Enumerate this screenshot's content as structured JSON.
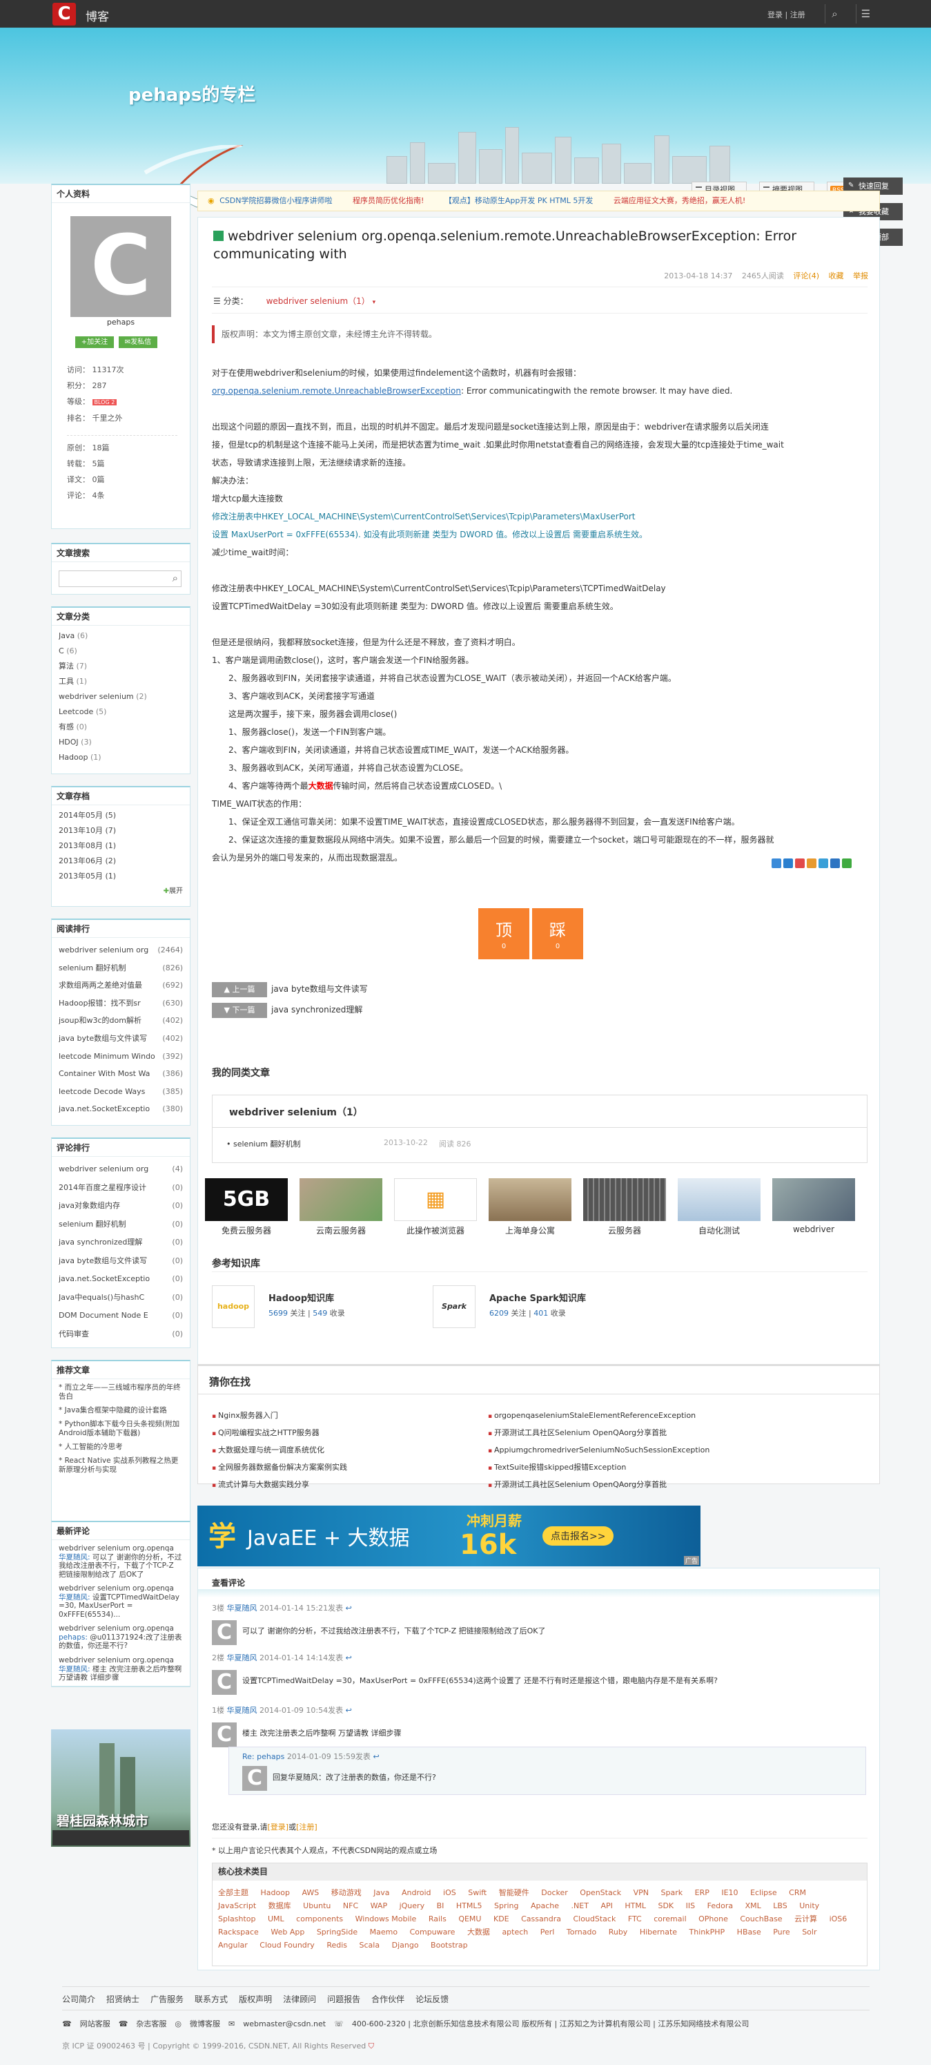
{
  "topbar": {
    "logo_text": "博客",
    "links": "登录 | 注册"
  },
  "banner": {
    "blog_title": "pehaps的专栏",
    "view_toc": "目录视图",
    "view_summary": "摘要视图",
    "rss": "RSS",
    "rss_label": "订阅"
  },
  "side_actions": [
    "快速回复",
    "我要收藏",
    "返回顶部"
  ],
  "profile": {
    "section_title": "个人资料",
    "username": "pehaps",
    "follow": "+加关注",
    "message": "✉发私信",
    "stats": [
      {
        "label": "访问：",
        "value": "11317次"
      },
      {
        "label": "积分：",
        "value": "287"
      },
      {
        "label": "等级：",
        "value": "BLOG 2"
      },
      {
        "label": "排名：",
        "value": "千里之外"
      }
    ],
    "counts": [
      {
        "label": "原创：",
        "value": "18篇"
      },
      {
        "label": "转载：",
        "value": "5篇"
      },
      {
        "label": "译文：",
        "value": "0篇"
      },
      {
        "label": "评论：",
        "value": "4条"
      }
    ]
  },
  "search": {
    "title": "文章搜索"
  },
  "categories": {
    "title": "文章分类",
    "items": [
      {
        "name": "Java",
        "count": "(6)"
      },
      {
        "name": "C",
        "count": "(6)"
      },
      {
        "name": "算法",
        "count": "(7)"
      },
      {
        "name": "工具",
        "count": "(1)"
      },
      {
        "name": "webdriver selenium",
        "count": "(2)"
      },
      {
        "name": "Leetcode",
        "count": "(5)"
      },
      {
        "name": "有感",
        "count": "(0)"
      },
      {
        "name": "HDOJ",
        "count": "(3)"
      },
      {
        "name": "Hadoop",
        "count": "(1)"
      }
    ]
  },
  "archive": {
    "title": "文章存档",
    "items": [
      "2014年05月 (5)",
      "2013年10月 (7)",
      "2013年08月 (1)",
      "2013年06月 (2)",
      "2013年05月 (1)"
    ],
    "more": "展开"
  },
  "top_read": {
    "title": "阅读排行",
    "items": [
      {
        "name": "webdriver selenium org",
        "count": "(2464)"
      },
      {
        "name": "selenium 翻好机制",
        "count": "(826)"
      },
      {
        "name": "求数组两两之差绝对值最",
        "count": "(692)"
      },
      {
        "name": "Hadoop报错：找不到sr",
        "count": "(630)"
      },
      {
        "name": "jsoup和w3c的dom解析",
        "count": "(402)"
      },
      {
        "name": "java byte数组与文件读写",
        "count": "(402)"
      },
      {
        "name": "leetcode Minimum Windo",
        "count": "(392)"
      },
      {
        "name": "Container With Most Wa",
        "count": "(386)"
      },
      {
        "name": "leetcode Decode Ways",
        "count": "(385)"
      },
      {
        "name": "java.net.SocketExceptio",
        "count": "(380)"
      }
    ]
  },
  "top_comment": {
    "title": "评论排行",
    "items": [
      {
        "name": "webdriver selenium org",
        "count": "(4)"
      },
      {
        "name": "2014年百度之星程序设计",
        "count": "(0)"
      },
      {
        "name": "java对象数组内存",
        "count": "(0)"
      },
      {
        "name": "selenium 翻好机制",
        "count": "(0)"
      },
      {
        "name": "java synchronized理解",
        "count": "(0)"
      },
      {
        "name": "java byte数组与文件读写",
        "count": "(0)"
      },
      {
        "name": "java.net.SocketExceptio",
        "count": "(0)"
      },
      {
        "name": "Java中equals()与hashC",
        "count": "(0)"
      },
      {
        "name": "DOM Document Node E",
        "count": "(0)"
      },
      {
        "name": "代码审查",
        "count": "(0)"
      }
    ]
  },
  "recommend": {
    "title": "推荐文章",
    "items": [
      "* 而立之年——三线城市程序员的年终告白",
      "* Java集合框架中隐藏的设计套路",
      "* Python脚本下载今日头条视频(附加Android版本辅助下载器)",
      "* 人工智能的冷思考",
      "* React Native 实战系列教程之热更新原理分析与实现"
    ]
  },
  "recent_comments": {
    "title": "最新评论",
    "items": [
      {
        "post": "webdriver selenium org.openqa",
        "who": "华夏随风:",
        "text": "可以了 谢谢你的分析，不过我给改注册表不行，下载了个TCP-Z 把链接限制给改了 后OK了"
      },
      {
        "post": "webdriver selenium org.openqa",
        "who": "华夏随风:",
        "text": "设置TCPTimedWaitDelay =30, MaxUserPort = 0xFFFE(65534)..."
      },
      {
        "post": "webdriver selenium org.openqa",
        "who": "pehaps:",
        "text": "@u011371924:改了注册表的数值，你还是不行?"
      },
      {
        "post": "webdriver selenium org.openqa",
        "who": "华夏随风:",
        "text": "楼主 改完注册表之后咋整啊 万望请教 详细步骤"
      }
    ]
  },
  "side_ad": {
    "text": "碧桂园森林城市"
  },
  "newsbar": [
    "CSDN学院招募微信小程序讲师啦",
    "程序员简历优化指南!",
    "【观点】移动原生App开发 PK HTML 5开发",
    "云端应用征文大赛，秀绝招，赢无人机!"
  ],
  "article": {
    "title": "webdriver selenium org.openqa.selenium.remote.UnreachableBrowserException: Error communicating with",
    "date": "2013-04-18 14:37",
    "reads": "2465人阅读",
    "comments": "评论(4)",
    "favorite": "收藏",
    "report": "举报",
    "category_label": "分类：",
    "category": "webdriver selenium（1）",
    "copyright": "版权声明：本文为博主原创文章，未经博主允许不得转载。",
    "p1": "对于在使用webdriver和selenium的时候，如果使用过findelement这个函数时，机器有时会报错：",
    "p2a": "org.openqa.selenium.remote.UnreachableBrowserException",
    "p2b": ": Error communicatingwith the remote browser. It may have died.",
    "p3": "出现这个问题的原因一直找不到，而且，出现的时机并不固定。最后才发现问题是socket连接达到上限，原因是由于：webdriver在请求服务以后关闭连",
    "p4": "接，但是tcp的机制是这个连接不能马上关闭，而是把状态置为time_wait .如果此时你用netstat查看自己的网络连接，会发现大量的tcp连接处于time_wait",
    "p5": "状态，导致请求连接到上限，无法继续请求新的连接。",
    "p6": "解决办法：",
    "p7": "增大tcp最大连接数",
    "p8": "修改注册表中HKEY_LOCAL_MACHINE\\System\\CurrentControlSet\\Services\\Tcpip\\Parameters\\MaxUserPort",
    "p9": "设置 MaxUserPort = 0xFFFE(65534). 如没有此项则新建 类型为 DWORD 值。修改以上设置后 需要重启系统生效。",
    "p10": "减少time_wait时间：",
    "p11": "修改注册表中HKEY_LOCAL_MACHINE\\System\\CurrentControlSet\\Services\\Tcpip\\Parameters\\TCPTimedWaitDelay",
    "p12": "设置TCPTimedWaitDelay =30如没有此项则新建 类型为: DWORD 值。修改以上设置后 需要重启系统生效。",
    "p13": "但是还是很纳闷，我都释放socket连接，但是为什么还是不释放，查了资料才明白。",
    "p14": "1、客户端是调用函数close()，这时，客户端会发送一个FIN给服务器。",
    "p15": "　　2、服务器收到FIN，关闭套接字读通道，并将自己状态设置为CLOSE_WAIT（表示被动关闭），并返回一个ACK给客户端。",
    "p16": "　　3、客户端收到ACK，关闭套接字写通道",
    "p17": "　　这是两次握手，接下来，服务器会调用close()",
    "p18": "　　1、服务器close()，发送一个FIN到客户端。",
    "p19": "　　2、客户端收到FIN，关闭读通道，并将自己状态设置成TIME_WAIT，发送一个ACK给服务器。",
    "p20": "　　3、服务器收到ACK，关闭写通道，并将自己状态设置为CLOSE。",
    "p21a": "　　4、客户端等待两个最",
    "p21b": "大数据",
    "p21c": "传输时间，然后将自己状态设置成CLOSED。\\",
    "p22": "TIME_WAIT状态的作用：",
    "p23": "　　1、保证全双工通信可靠关闭：如果不设置TIME_WAIT状态，直接设置成CLOSED状态，那么服务器得不到回复，会一直发送FIN给客户端。",
    "p24": "　　2、保证这次连接的重复数据段从网络中消失。如果不设置，那么最后一个回复的时候，需要建立一个socket，端口号可能跟现在的不一样，服务器就",
    "p25": "会认为是另外的端口号发来的，从而出现数据混乱。"
  },
  "vote": {
    "up": "顶",
    "up_count": "0",
    "down": "踩",
    "down_count": "0"
  },
  "nav": {
    "prev_label": "上一篇",
    "prev": "java byte数组与文件读写",
    "next_label": "下一篇",
    "next": "java synchronized理解"
  },
  "related": {
    "title": "我的同类文章",
    "category": "webdriver selenium（1）",
    "item": "selenium 翻好机制",
    "date": "2013-10-22",
    "reads": "阅读 826"
  },
  "thumbs": [
    "免费云服务器",
    "云南云服务器",
    "此操作被浏览器",
    "上海单身公寓",
    "云服务器",
    "自动化测试",
    "webdriver"
  ],
  "knowledge": {
    "title": "参考知识库",
    "items": [
      {
        "name": "Hadoop知识库",
        "follow": "5699",
        "follow_label": "关注",
        "collect": "549",
        "collect_label": "收录",
        "icon": "hadoop"
      },
      {
        "name": "Apache Spark知识库",
        "follow": "6209",
        "follow_label": "关注",
        "collect": "401",
        "collect_label": "收录",
        "icon": "Spark"
      }
    ]
  },
  "guess": {
    "title": "猜你在找",
    "left": [
      "Nginx服务器入门",
      "Q问啦编程实战之HTTP服务器",
      "大数据处理与统一调度系统优化",
      "全网服务器数据备份解决方案案例实践",
      "流式计算与大数据实践分享"
    ],
    "right": [
      "orgopenqaseleniumStaleElementReferenceException",
      "开源测试工具社区Selenium OpenQAorg分享首批",
      "AppiumgchromedriverSeleniumNoSuchSessionException",
      "TextSuite报错skipped报错Exception",
      "开源测试工具社区Selenium OpenQAorg分享首批"
    ]
  },
  "ad": {
    "text1": "学",
    "text2": "JavaEE + 大数据",
    "text3": "冲刺月薪",
    "text4": "16k",
    "btn": "点击报名>>",
    "tag": "广告"
  },
  "comments": {
    "title": "查看评论",
    "items": [
      {
        "floor": "3楼",
        "who": "华夏随风",
        "date": "2014-01-14 15:21发表",
        "text": "可以了 谢谢你的分析，不过我给改注册表不行，下载了个TCP-Z 把链接限制给改了后OK了"
      },
      {
        "floor": "2楼",
        "who": "华夏随风",
        "date": "2014-01-14 14:14发表",
        "text": "设置TCPTimedWaitDelay =30，MaxUserPort = 0xFFFE(65534)这两个设置了 还是不行有时还是报这个错，跟电脑内存是不是有关系啊?"
      },
      {
        "floor": "1楼",
        "who": "华夏随风",
        "date": "2014-01-09 10:54发表",
        "text": "楼主 改完注册表之后咋整啊 万望请教 详细步骤"
      }
    ],
    "reply": {
      "label": "Re:",
      "who": "pehaps",
      "date": "2014-01-09 15:59发表",
      "text": "回复华夏随风：改了注册表的数值，你还是不行?"
    },
    "login_hint_a": "您还没有登录,请",
    "login": "[登录]",
    "or": "或",
    "register": "[注册]",
    "note": "* 以上用户言论只代表其个人观点，不代表CSDN网站的观点或立场",
    "tags_title": "核心技术类目",
    "tags": [
      "全部主题",
      "Hadoop",
      "AWS",
      "移动游戏",
      "Java",
      "Android",
      "iOS",
      "Swift",
      "智能硬件",
      "Docker",
      "OpenStack",
      "VPN",
      "Spark",
      "ERP",
      "IE10",
      "Eclipse",
      "CRM",
      "JavaScript",
      "数据库",
      "Ubuntu",
      "NFC",
      "WAP",
      "jQuery",
      "BI",
      "HTML5",
      "Spring",
      "Apache",
      ".NET",
      "API",
      "HTML",
      "SDK",
      "IIS",
      "Fedora",
      "XML",
      "LBS",
      "Unity",
      "Splashtop",
      "UML",
      "components",
      "Windows Mobile",
      "Rails",
      "QEMU",
      "KDE",
      "Cassandra",
      "CloudStack",
      "FTC",
      "coremail",
      "OPhone",
      "CouchBase",
      "云计算",
      "iOS6",
      "Rackspace",
      "Web App",
      "SpringSide",
      "Maemo",
      "Compuware",
      "大数据",
      "aptech",
      "Perl",
      "Tornado",
      "Ruby",
      "Hibernate",
      "ThinkPHP",
      "HBase",
      "Pure",
      "Solr",
      "Angular",
      "Cloud Foundry",
      "Redis",
      "Scala",
      "Django",
      "Bootstrap"
    ]
  },
  "footer": {
    "links": [
      "公司简介",
      "招贤纳士",
      "广告服务",
      "联系方式",
      "版权声明",
      "法律顾问",
      "问题报告",
      "合作伙伴",
      "论坛反馈"
    ],
    "contacts": [
      "网站客服",
      "杂志客服",
      "微博客服",
      "webmaster@csdn.net",
      "400-600-2320 | 北京创新乐知信息技术有限公司 版权所有 | 江苏知之为计算机有限公司 | 江苏乐知网络技术有限公司"
    ],
    "copy": "京 ICP 证 09002463 号 | Copyright © 1999-2016, CSDN.NET, All Rights Reserved"
  }
}
